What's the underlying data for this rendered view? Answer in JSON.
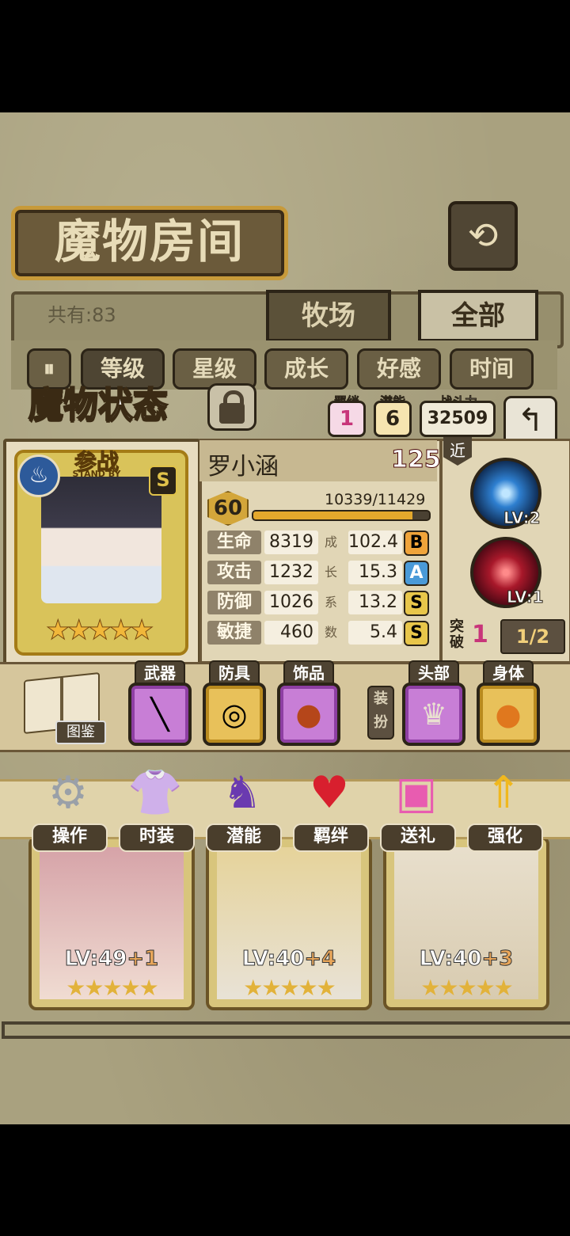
{
  "header": {
    "title": "魔物房间",
    "back_icon": "back-arrow-icon"
  },
  "filter": {
    "total_label": "共有:83",
    "tabs": [
      {
        "label": "牧场"
      },
      {
        "label": "全部"
      }
    ],
    "sort": [
      {
        "label": "等级"
      },
      {
        "label": "星级"
      },
      {
        "label": "成长"
      },
      {
        "label": "好感"
      },
      {
        "label": "时间"
      }
    ]
  },
  "background_cards": [
    {
      "lv": "LV:49",
      "plus": "+1"
    },
    {
      "lv": "LV:40",
      "plus": "+4"
    },
    {
      "lv": "LV:40",
      "plus": "+3"
    }
  ],
  "status": {
    "title": "魔物状态",
    "bond_label": "羁绊",
    "bond_value": "1",
    "potential_label": "潜能",
    "potential_value": "6",
    "power_label": "战斗力",
    "power_value": "32509",
    "standby_label": "参战",
    "standby_sub": "STAND BY",
    "rank": "S",
    "stars": "★★★★★",
    "name": "罗小涵",
    "affection": "125",
    "level": "60",
    "exp_text": "10339/11429",
    "exp_fraction": 0.9046,
    "stats": [
      {
        "label": "生命",
        "value": "8319",
        "growth": "102.4",
        "grade": "B"
      },
      {
        "label": "攻击",
        "value": "1232",
        "growth": "15.3",
        "grade": "A"
      },
      {
        "label": "防御",
        "value": "1026",
        "growth": "13.2",
        "grade": "S"
      },
      {
        "label": "敏捷",
        "value": "460",
        "growth": "5.4",
        "grade": "S"
      }
    ],
    "growth_side_label": [
      "成",
      "长",
      "系",
      "数"
    ],
    "range_tag": "近",
    "skills": [
      {
        "lv": "LV:2"
      },
      {
        "lv": "LV:1"
      }
    ],
    "break_label": "突破",
    "break_value": "1",
    "break_frac": "1/2"
  },
  "equipment": {
    "book_label": "图鉴",
    "slots": [
      {
        "title": "武器",
        "icon": "selfie-stick-icon"
      },
      {
        "title": "防具",
        "icon": "ring-icon"
      },
      {
        "title": "饰品",
        "icon": "amber-brooch-icon"
      },
      {
        "title": "头部",
        "icon": "tiara-icon"
      },
      {
        "title": "身体",
        "icon": "pumpkin-icon"
      }
    ],
    "dress_label": "装扮"
  },
  "actions": [
    {
      "label": "操作",
      "icon": "gear-icon"
    },
    {
      "label": "时装",
      "icon": "clothes-icon"
    },
    {
      "label": "潜能",
      "icon": "demon-icon"
    },
    {
      "label": "羁绊",
      "icon": "hearts-icon"
    },
    {
      "label": "送礼",
      "icon": "gift-icon"
    },
    {
      "label": "强化",
      "icon": "upgrade-arrow-icon"
    }
  ],
  "colors": {
    "grade_B": "#f0a43a",
    "grade_A": "#4a9ad8",
    "grade_S": "#e8c64a",
    "bond_pink": "#c8357a",
    "potential_gold": "#f2c74a"
  }
}
